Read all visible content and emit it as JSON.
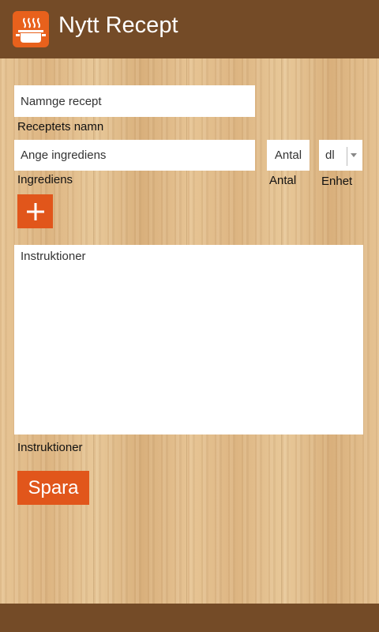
{
  "header": {
    "title": "Nytt Recept",
    "icon": "pot-icon",
    "accent": "#e8611c",
    "bar_color": "#744b27"
  },
  "form": {
    "name_placeholder": "Namnge recept",
    "name_label": "Receptets namn",
    "ingredient_placeholder": "Ange ingrediens",
    "ingredient_label": "Ingrediens",
    "amount_placeholder": "Antal",
    "amount_label": "Antal",
    "unit_value": "dl",
    "unit_label": "Enhet",
    "add_button": "+",
    "instructions_placeholder": "Instruktioner",
    "instructions_label": "Instruktioner",
    "save_button": "Spara",
    "button_color": "#e1561b"
  }
}
